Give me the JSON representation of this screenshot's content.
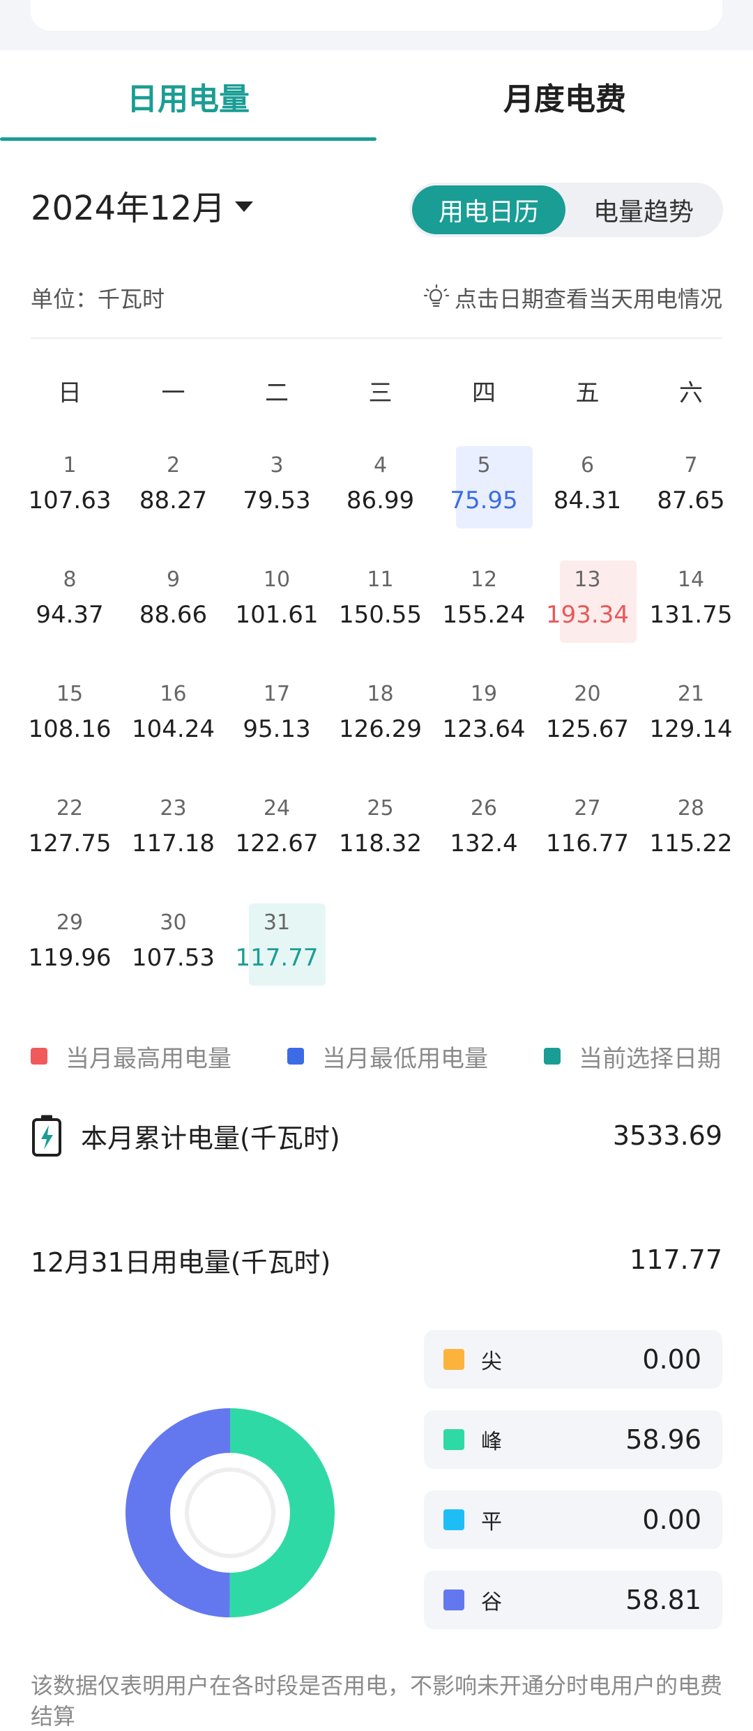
{
  "tabs": [
    {
      "label": "日用电量",
      "active": true
    },
    {
      "label": "月度电费",
      "active": false
    }
  ],
  "month": {
    "label": "2024年12月"
  },
  "view_toggle": {
    "calendar": "用电日历",
    "trend": "电量趋势"
  },
  "unit_label": "单位：千瓦时",
  "hint": "点击日期查看当天用电情况",
  "weekdays": [
    "日",
    "一",
    "二",
    "三",
    "四",
    "五",
    "六"
  ],
  "first_weekday": 0,
  "days": [
    {
      "d": "1",
      "v": "107.63"
    },
    {
      "d": "2",
      "v": "88.27"
    },
    {
      "d": "3",
      "v": "79.53"
    },
    {
      "d": "4",
      "v": "86.99"
    },
    {
      "d": "5",
      "v": "75.95",
      "mark": "min"
    },
    {
      "d": "6",
      "v": "84.31"
    },
    {
      "d": "7",
      "v": "87.65"
    },
    {
      "d": "8",
      "v": "94.37"
    },
    {
      "d": "9",
      "v": "88.66"
    },
    {
      "d": "10",
      "v": "101.61"
    },
    {
      "d": "11",
      "v": "150.55"
    },
    {
      "d": "12",
      "v": "155.24"
    },
    {
      "d": "13",
      "v": "193.34",
      "mark": "max"
    },
    {
      "d": "14",
      "v": "131.75"
    },
    {
      "d": "15",
      "v": "108.16"
    },
    {
      "d": "16",
      "v": "104.24"
    },
    {
      "d": "17",
      "v": "95.13"
    },
    {
      "d": "18",
      "v": "126.29"
    },
    {
      "d": "19",
      "v": "123.64"
    },
    {
      "d": "20",
      "v": "125.67"
    },
    {
      "d": "21",
      "v": "129.14"
    },
    {
      "d": "22",
      "v": "127.75"
    },
    {
      "d": "23",
      "v": "117.18"
    },
    {
      "d": "24",
      "v": "122.67"
    },
    {
      "d": "25",
      "v": "118.32"
    },
    {
      "d": "26",
      "v": "132.4"
    },
    {
      "d": "27",
      "v": "116.77"
    },
    {
      "d": "28",
      "v": "115.22"
    },
    {
      "d": "29",
      "v": "119.96"
    },
    {
      "d": "30",
      "v": "107.53"
    },
    {
      "d": "31",
      "v": "117.77",
      "mark": "selected"
    }
  ],
  "legend": [
    {
      "label": "当月最高用电量",
      "color": "#f05a5a"
    },
    {
      "label": "当月最低用电量",
      "color": "#3c6be6"
    },
    {
      "label": "当前选择日期",
      "color": "#1a9d94"
    }
  ],
  "mark_colors": {
    "max": {
      "bg": "#fdecec",
      "text": "#e85858"
    },
    "min": {
      "bg": "#e9efff",
      "text": "#3c6be6"
    },
    "selected": {
      "bg": "#e6f6f4",
      "text": "#1a9d94"
    }
  },
  "monthly_total": {
    "label": "本月累计电量(千瓦时)",
    "value": "3533.69"
  },
  "day_total": {
    "label": "12月31日用电量(千瓦时)",
    "value": "117.77"
  },
  "periods": [
    {
      "label": "尖",
      "value": "0.00",
      "color": "#fbb33c"
    },
    {
      "label": "峰",
      "value": "58.96",
      "color": "#2fd9a6"
    },
    {
      "label": "平",
      "value": "0.00",
      "color": "#1fbdf5"
    },
    {
      "label": "谷",
      "value": "58.81",
      "color": "#6378ef"
    }
  ],
  "note": "该数据仅表明用户在各时段是否用电，不影响未开通分时电用户的电费结算"
}
